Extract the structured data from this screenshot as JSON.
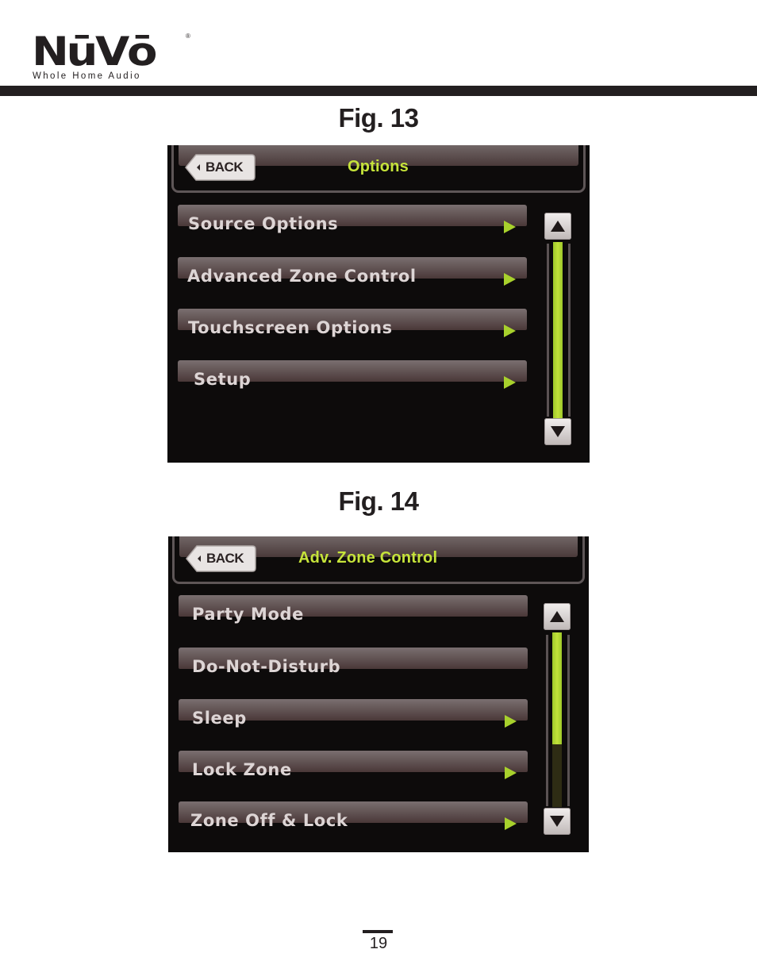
{
  "logo": {
    "brand": "NūVō",
    "registered": "®",
    "tagline": "Whole Home Audio"
  },
  "figures": [
    {
      "caption": "Fig. 13",
      "screen": {
        "back_label": "BACK",
        "title": "Options",
        "items": [
          {
            "label": "Source Options",
            "has_arrow": true
          },
          {
            "label": "Advanced Zone Control",
            "has_arrow": true
          },
          {
            "label": "Touchscreen Options",
            "has_arrow": true
          },
          {
            "label": "Setup",
            "has_arrow": true
          }
        ],
        "scrollbar": {
          "thumb_start": 0.0,
          "thumb_end": 1.0
        }
      }
    },
    {
      "caption": "Fig. 14",
      "screen": {
        "back_label": "BACK",
        "title": "Adv. Zone Control",
        "items": [
          {
            "label": "Party Mode",
            "has_arrow": false
          },
          {
            "label": "Do-Not-Disturb",
            "has_arrow": false
          },
          {
            "label": "Sleep",
            "has_arrow": true
          },
          {
            "label": "Lock Zone",
            "has_arrow": true
          },
          {
            "label": "Zone Off & Lock",
            "has_arrow": true
          }
        ],
        "scrollbar": {
          "thumb_start": 0.0,
          "thumb_end": 0.64
        }
      }
    }
  ],
  "colors": {
    "accent_green": "#a8d12c",
    "title_green": "#c6e43a",
    "screen_bg": "#0d0b0b"
  },
  "page_number": "19"
}
